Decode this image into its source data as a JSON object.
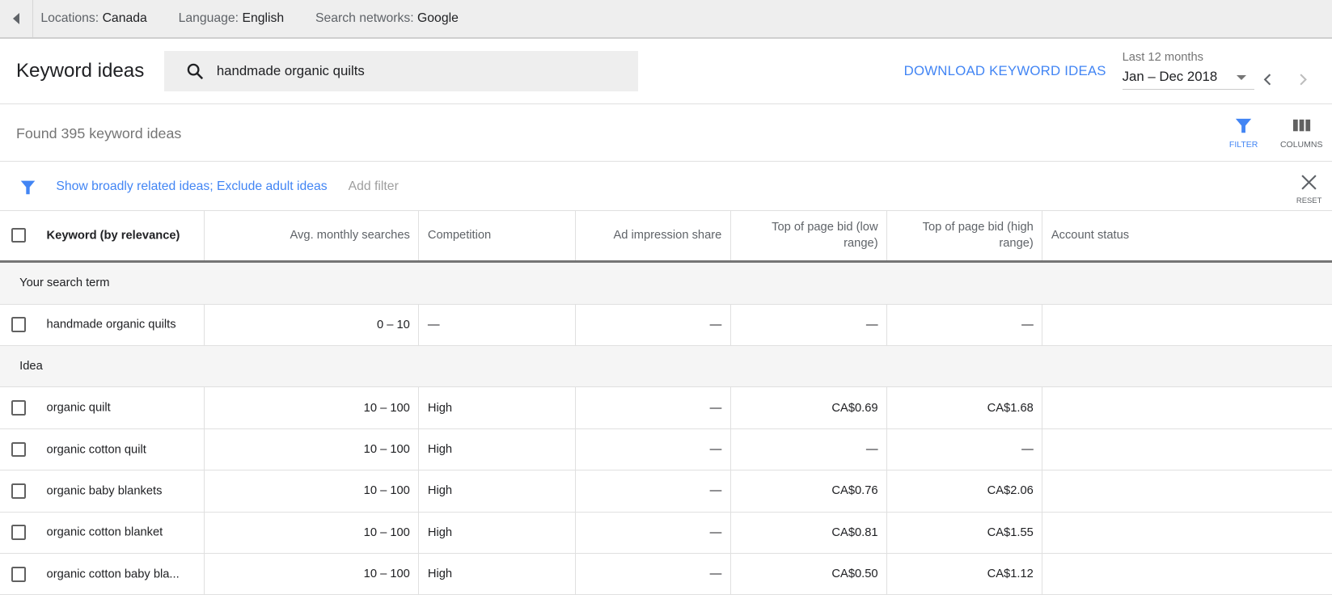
{
  "topbar": {
    "items": [
      {
        "label": "Locations:",
        "value": "Canada"
      },
      {
        "label": "Language:",
        "value": "English"
      },
      {
        "label": "Search networks:",
        "value": "Google"
      }
    ]
  },
  "header": {
    "title": "Keyword ideas",
    "search_value": "handmade organic quilts",
    "download_label": "DOWNLOAD KEYWORD IDEAS",
    "date_label": "Last 12 months",
    "date_value": "Jan – Dec 2018"
  },
  "found": {
    "text": "Found 395 keyword ideas",
    "filter_label": "FILTER",
    "columns_label": "COLUMNS"
  },
  "filters": {
    "applied": "Show broadly related ideas; Exclude adult ideas",
    "add_label": "Add filter",
    "reset_label": "RESET"
  },
  "accent": "#4285f4",
  "table": {
    "columns": [
      "Keyword (by relevance)",
      "Avg. monthly searches",
      "Competition",
      "Ad impression share",
      "Top of page bid (low range)",
      "Top of page bid (high range)",
      "Account status"
    ],
    "search_section": "Your search term",
    "search_rows": [
      [
        "handmade organic quilts",
        "0 – 10",
        "—",
        "—",
        "—",
        "—",
        ""
      ]
    ],
    "idea_section": "Idea",
    "idea_rows": [
      [
        "organic quilt",
        "10 – 100",
        "High",
        "—",
        "CA$0.69",
        "CA$1.68",
        ""
      ],
      [
        "organic cotton quilt",
        "10 – 100",
        "High",
        "—",
        "—",
        "—",
        ""
      ],
      [
        "organic baby blankets",
        "10 – 100",
        "High",
        "—",
        "CA$0.76",
        "CA$2.06",
        ""
      ],
      [
        "organic cotton blanket",
        "10 – 100",
        "High",
        "—",
        "CA$0.81",
        "CA$1.55",
        ""
      ],
      [
        "organic cotton baby bla...",
        "10 – 100",
        "High",
        "—",
        "CA$0.50",
        "CA$1.12",
        ""
      ]
    ]
  }
}
